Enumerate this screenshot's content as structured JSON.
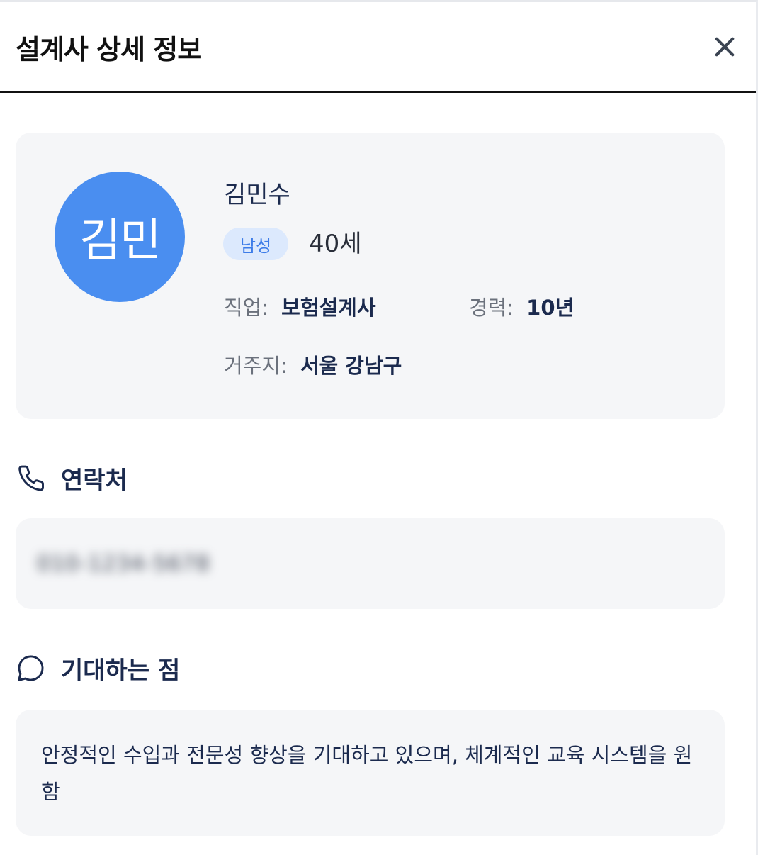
{
  "header": {
    "title": "설계사 상세 정보",
    "close_icon": "close-icon"
  },
  "profile": {
    "avatar_text": "김민",
    "avatar_color": "#4a8ef0",
    "name": "김민수",
    "gender": "남성",
    "age": "40세",
    "job_label": "직업:",
    "job_value": "보험설계사",
    "career_label": "경력:",
    "career_value": "10년",
    "residence_label": "거주지:",
    "residence_value": "서울 강남구"
  },
  "contact": {
    "title": "연락처",
    "icon": "phone-icon",
    "phone": "010-1234-5678"
  },
  "expectation": {
    "title": "기대하는 점",
    "icon": "chat-bubble-icon",
    "text": "안정적인 수입과 전문성 향상을 기대하고 있으며, 체계적인 교육 시스템을 원함"
  }
}
